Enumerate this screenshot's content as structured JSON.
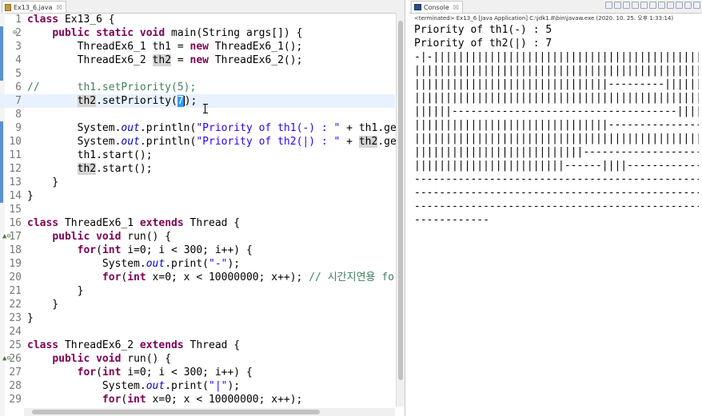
{
  "editor": {
    "tab_label": "Ex13_6.java",
    "tab_close": "☒",
    "lines": [
      {
        "n": "1",
        "marker": "",
        "cur": false,
        "html": "<span class=\"kw\">class</span> Ex13_6 {"
      },
      {
        "n": "2",
        "marker": "⊖",
        "cur": false,
        "html": "    <span class=\"kw\">public</span> <span class=\"kw\">static</span> <span class=\"kw\">void</span> main(String args[]) {"
      },
      {
        "n": "3",
        "marker": "",
        "cur": false,
        "html": "        ThreadEx6_1 th1 = <span class=\"kw\">new</span> ThreadEx6_1();"
      },
      {
        "n": "4",
        "marker": "",
        "cur": false,
        "html": "        ThreadEx6_2 <span class=\"occ\">th2</span> = <span class=\"kw\">new</span> ThreadEx6_2();"
      },
      {
        "n": "5",
        "marker": "",
        "cur": false,
        "html": ""
      },
      {
        "n": "6",
        "marker": "",
        "cur": false,
        "html": "<span class=\"cmt\">//      th1.setPriority(5);</span>"
      },
      {
        "n": "7",
        "marker": "",
        "cur": true,
        "html": "        <span class=\"occ\">th2</span>.setPriority(<span class=\"sel\">7</span>);"
      },
      {
        "n": "8",
        "marker": "",
        "cur": false,
        "html": ""
      },
      {
        "n": "9",
        "marker": "",
        "cur": false,
        "html": "        System.<span class=\"fld\">out</span>.println(<span class=\"str\">\"Priority of th1(-) : \"</span> + th1.ge"
      },
      {
        "n": "10",
        "marker": "",
        "cur": false,
        "html": "        System.<span class=\"fld\">out</span>.println(<span class=\"str\">\"Priority of th2(|) : \"</span> + <span class=\"occ\">th2</span>.ge"
      },
      {
        "n": "11",
        "marker": "",
        "cur": false,
        "html": "        th1.start();"
      },
      {
        "n": "12",
        "marker": "",
        "cur": false,
        "html": "        <span class=\"occ\">th2</span>.start();"
      },
      {
        "n": "13",
        "marker": "",
        "cur": false,
        "html": "    }"
      },
      {
        "n": "14",
        "marker": "",
        "cur": false,
        "html": "}"
      },
      {
        "n": "15",
        "marker": "",
        "cur": false,
        "html": ""
      },
      {
        "n": "16",
        "marker": "",
        "cur": false,
        "html": "<span class=\"kw\">class</span> ThreadEx6_1 <span class=\"kw\">extends</span> Thread {"
      },
      {
        "n": "17",
        "marker": "▲⊖",
        "cur": false,
        "html": "    <span class=\"kw\">public</span> <span class=\"kw\">void</span> run() {"
      },
      {
        "n": "18",
        "marker": "",
        "cur": false,
        "html": "        <span class=\"kw\">for</span>(<span class=\"kw\">int</span> i=0; i &lt; 300; i++) {"
      },
      {
        "n": "19",
        "marker": "",
        "cur": false,
        "html": "            System.<span class=\"fld\">out</span>.print(<span class=\"str\">\"-\"</span>);"
      },
      {
        "n": "20",
        "marker": "",
        "cur": false,
        "html": "            <span class=\"kw\">for</span>(<span class=\"kw\">int</span> x=0; x &lt; 10000000; x++); <span class=\"cmt\">// 시간지연용 for</span>"
      },
      {
        "n": "21",
        "marker": "",
        "cur": false,
        "html": "        }"
      },
      {
        "n": "22",
        "marker": "",
        "cur": false,
        "html": "    }"
      },
      {
        "n": "23",
        "marker": "",
        "cur": false,
        "html": "}"
      },
      {
        "n": "24",
        "marker": "",
        "cur": false,
        "html": ""
      },
      {
        "n": "25",
        "marker": "",
        "cur": false,
        "html": "<span class=\"kw\">class</span> ThreadEx6_2 <span class=\"kw\">extends</span> Thread {"
      },
      {
        "n": "26",
        "marker": "▲⊖",
        "cur": false,
        "html": "    <span class=\"kw\">public</span> <span class=\"kw\">void</span> run() {"
      },
      {
        "n": "27",
        "marker": "",
        "cur": false,
        "html": "        <span class=\"kw\">for</span>(<span class=\"kw\">int</span> i=0; i &lt; 300; i++) {"
      },
      {
        "n": "28",
        "marker": "",
        "cur": false,
        "html": "            System.<span class=\"fld\">out</span>.print(<span class=\"str\">\"|\"</span>);"
      },
      {
        "n": "29",
        "marker": "",
        "cur": false,
        "html": "            <span class=\"kw\">for</span>(<span class=\"kw\">int</span> x=0; x &lt; 10000000; x++);"
      }
    ]
  },
  "console": {
    "tab_label": "Console",
    "tab_close": "☒",
    "header": "<terminated> Ex13_6 [Java Application] C:\\jdk1.8\\bin\\javaw.exe (2020. 10. 25. 오후 1:33:14)",
    "output": [
      "Priority of th1(-) : 5",
      "Priority of th2(|) : 7",
      "-|-||||||||||||||||||||||||||||||||||||||||||||||||||||||||||||||||||||||||",
      "||||||||||||||||||||||||||||||||||||||||||||||||||||||||||||||||||||||||||||",
      "|||||||||||||||||||||||||||||||---------||||||||||||||||||||||||||||||||||||",
      "||||||||||||||||||||||||||||||||||||||||||||||||||||||||||||||||||||||||||||",
      "||||||------------------------------------||||||||||||||||||||||||||||||||||",
      "|||||||||||||||||||||||||||||||---------------------------------------------",
      "|||||||||||||||||||||||||||||||||||||||||||||||||||||||||||||||||||||||||||||",
      "|||||||||||||||||||||||||||----------------------||||||||||||||||||||||||||",
      "||||||||||||||||||||||||------||||-----------------------------------------",
      "---------------------------------------------------------------------------",
      "---------------------------------------------------------------------------",
      "---------------------------------------------------------------------------",
      "------------"
    ]
  }
}
